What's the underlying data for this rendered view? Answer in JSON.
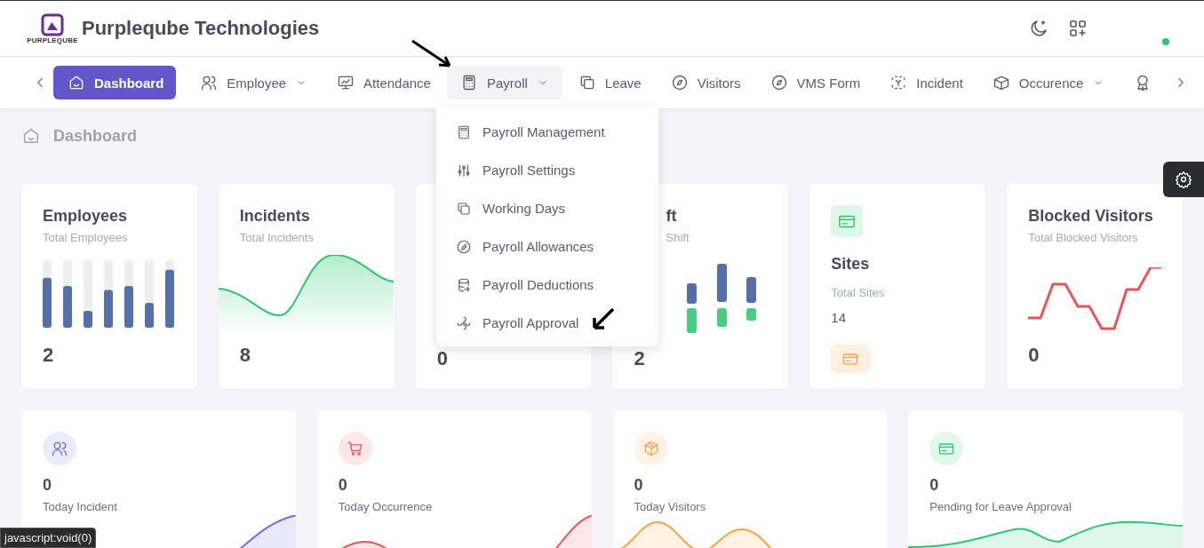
{
  "header": {
    "logo_text": "PURPLEQUBE",
    "company": "Purpleqube Technologies",
    "online": true
  },
  "nav": {
    "items": [
      {
        "label": "Dashboard",
        "selected": true,
        "expanded": false,
        "dropdown": false
      },
      {
        "label": "Employee",
        "selected": false,
        "expanded": false,
        "dropdown": true
      },
      {
        "label": "Attendance",
        "selected": false,
        "expanded": false,
        "dropdown": false
      },
      {
        "label": "Payroll",
        "selected": false,
        "expanded": true,
        "dropdown": true
      },
      {
        "label": "Leave",
        "selected": false,
        "expanded": false,
        "dropdown": false
      },
      {
        "label": "Visitors",
        "selected": false,
        "expanded": false,
        "dropdown": false
      },
      {
        "label": "VMS Form",
        "selected": false,
        "expanded": false,
        "dropdown": false
      },
      {
        "label": "Incident",
        "selected": false,
        "expanded": false,
        "dropdown": false
      },
      {
        "label": "Occurence",
        "selected": false,
        "expanded": false,
        "dropdown": true
      },
      {
        "selected": false,
        "expanded": false,
        "dropdown": false
      }
    ]
  },
  "payroll_menu": [
    "Payroll Management",
    "Payroll Settings",
    "Working Days",
    "Payroll Allowances",
    "Payroll Deductions",
    "Payroll Approval"
  ],
  "breadcrumb": "Dashboard",
  "stat_cards": [
    {
      "kind": "bars",
      "title": "Employees",
      "subtitle": "Total Employees",
      "value": "2"
    },
    {
      "kind": "area",
      "title": "Incidents",
      "subtitle": "Total Incidents",
      "value": "8"
    },
    {
      "kind": "hidden",
      "value": "0"
    },
    {
      "kind": "pairs",
      "title": "ft",
      "subtitle": "Shift",
      "value": "2"
    },
    {
      "kind": "icon",
      "title": "Sites",
      "subtitle": "Total Sites",
      "value": "14"
    },
    {
      "kind": "line",
      "title": "Blocked Visitors",
      "subtitle": "Total Blocked Visitors",
      "value": "0"
    }
  ],
  "today_cards": [
    {
      "value": "0",
      "label": "Today Incident",
      "color": "#7367f0"
    },
    {
      "value": "0",
      "label": "Today Occurrence",
      "color": "#ea5455"
    },
    {
      "value": "0",
      "label": "Today Visitors",
      "color": "#ff9f43"
    },
    {
      "value": "0",
      "label": "Pending for Leave Approval",
      "color": "#28c76f"
    }
  ],
  "status_tooltip": "javascript:void(0)"
}
